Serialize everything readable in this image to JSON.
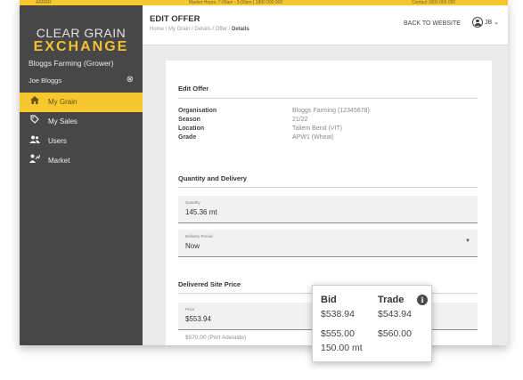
{
  "top_strip": {
    "left_text": "ARRRR",
    "center_text": "Market Hours: 7:00am - 5:00pm | 1800 000 000",
    "right_text": "Contact 1800 000 000"
  },
  "logo": {
    "line1": "CLEAR GRAIN",
    "line2": "EXCHANGE"
  },
  "sidebar": {
    "org_name": "Bloggs Farming (Grower)",
    "user_name": "Joe Bloggs",
    "items": [
      {
        "label": "My Grain",
        "icon": "home-icon",
        "active": true
      },
      {
        "label": "My Sales",
        "icon": "tag-icon",
        "active": false
      },
      {
        "label": "Users",
        "icon": "users-icon",
        "active": false
      },
      {
        "label": "Market",
        "icon": "market-icon",
        "active": false
      }
    ]
  },
  "header": {
    "title": "EDIT OFFER",
    "breadcrumb": [
      "Home",
      "My Grain",
      "Details",
      "Offer",
      "Details"
    ],
    "back_label": "BACK TO WEBSITE",
    "account_initials": "JB"
  },
  "edit_offer": {
    "heading": "Edit Offer",
    "rows": [
      {
        "key": "Organisation",
        "value": "Bloggs Farming (12345678)"
      },
      {
        "key": "Season",
        "value": "21/22"
      },
      {
        "key": "Location",
        "value": "Tailem Bend (VIT)"
      },
      {
        "key": "Grade",
        "value": "APW1 (Wheat)"
      }
    ]
  },
  "quantity_delivery": {
    "heading": "Quantity and Delivery",
    "quantity_label": "Quantity",
    "quantity_value": "145.36 mt",
    "delivery_label": "Delivery Period",
    "delivery_value": "Now"
  },
  "delivered_price": {
    "heading": "Delivered Site Price",
    "price_label": "Price",
    "price_value": "$553.94",
    "port_line": "$570.00 (Port Adelaide)"
  },
  "popover": {
    "bid_header": "Bid",
    "trade_header": "Trade",
    "bid_value": "$538.94",
    "trade_value": "$543.94",
    "bid_value2": "$555.00",
    "trade_value2": "$560.00",
    "quantity": "150.00 mt"
  },
  "colors": {
    "accent": "#f6c72e",
    "sidebar_bg": "#474747"
  }
}
